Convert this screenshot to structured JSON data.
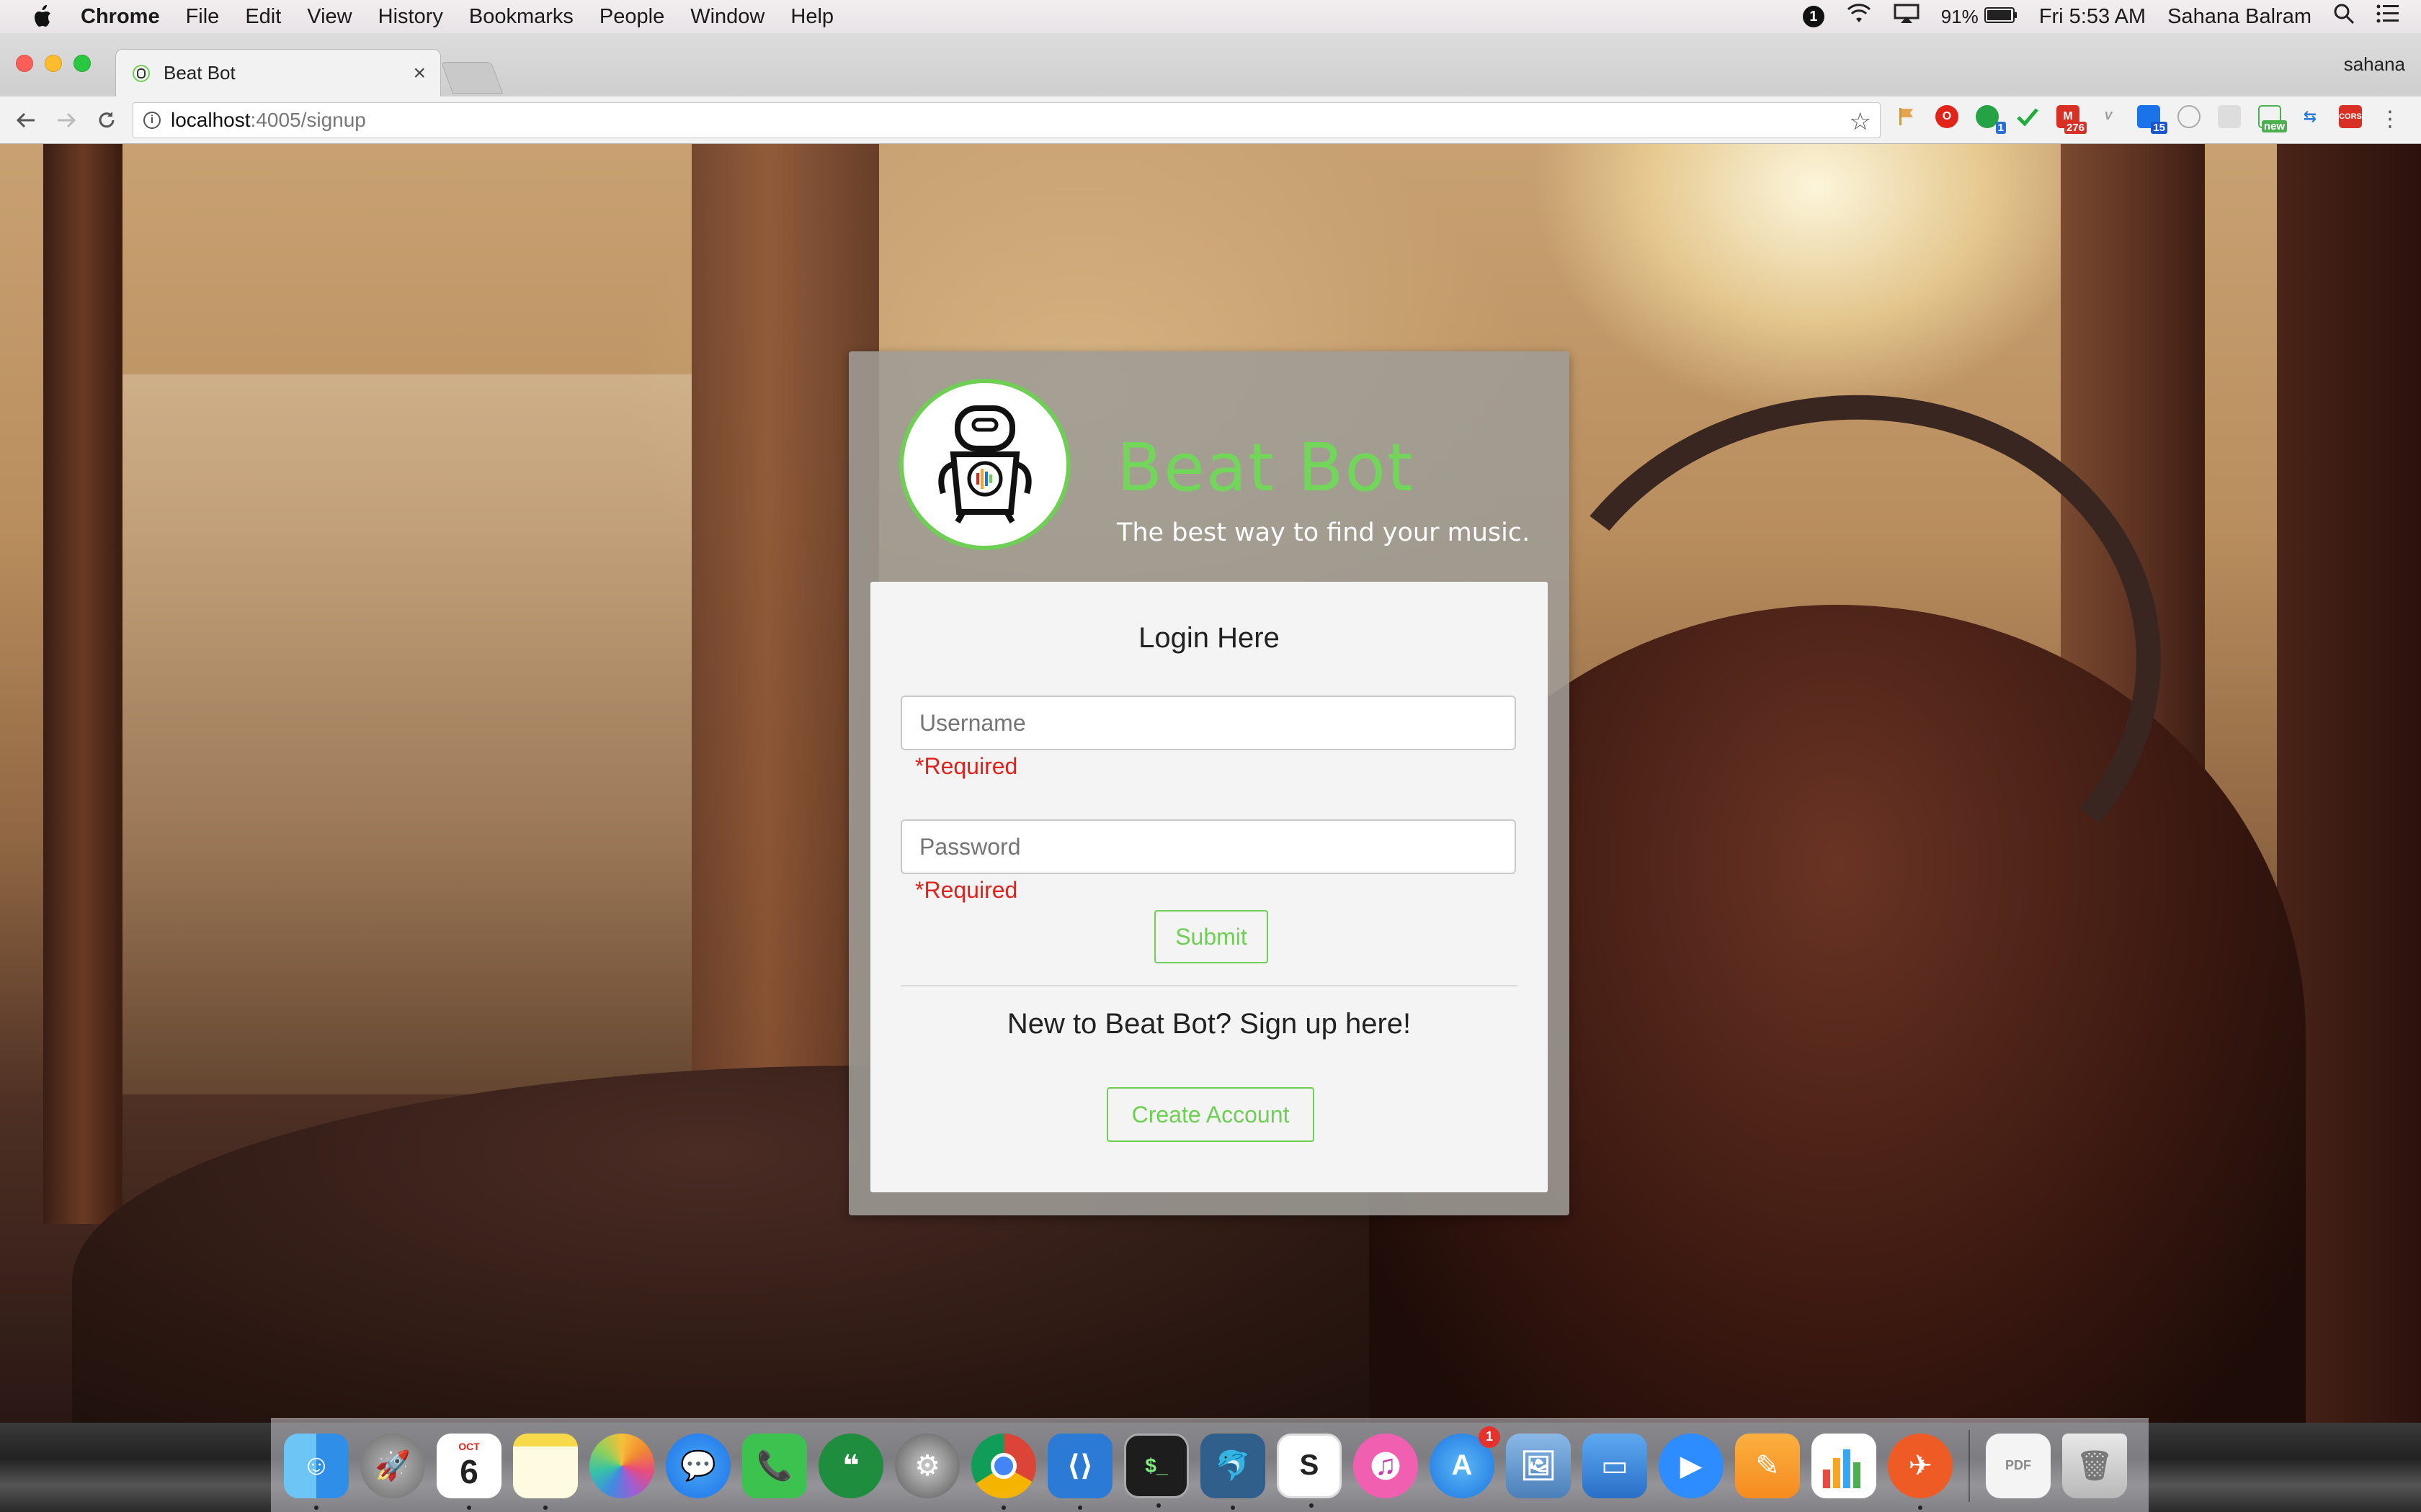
{
  "menubar": {
    "app": "Chrome",
    "menus": [
      "File",
      "Edit",
      "View",
      "History",
      "Bookmarks",
      "People",
      "Window",
      "Help"
    ],
    "battery": "91%",
    "clock": "Fri 5:53 AM",
    "user": "Sahana Balram",
    "notif_badge": "1"
  },
  "browser": {
    "tab_title": "Beat Bot",
    "profile_name": "sahana",
    "url_host": "localhost",
    "url_path": ":4005/signup",
    "ext_badges": {
      "mail": "276",
      "calendar": "15",
      "ext_green": "1",
      "new": "new",
      "cors": "CORS"
    }
  },
  "login": {
    "brand_title": "Beat Bot",
    "tagline": "The best way to find your music.",
    "heading": "Login Here",
    "username_placeholder": "Username",
    "password_placeholder": "Password",
    "required_text": "*Required",
    "submit_label": "Submit",
    "signup_prompt": "New to Beat Bot? Sign up here!",
    "create_account_label": "Create Account"
  },
  "dock": {
    "calendar_month": "OCT",
    "calendar_day": "6",
    "appstore_badge": "1"
  },
  "colors": {
    "accent_green": "#6fcf54",
    "error_red": "#e0211c"
  }
}
